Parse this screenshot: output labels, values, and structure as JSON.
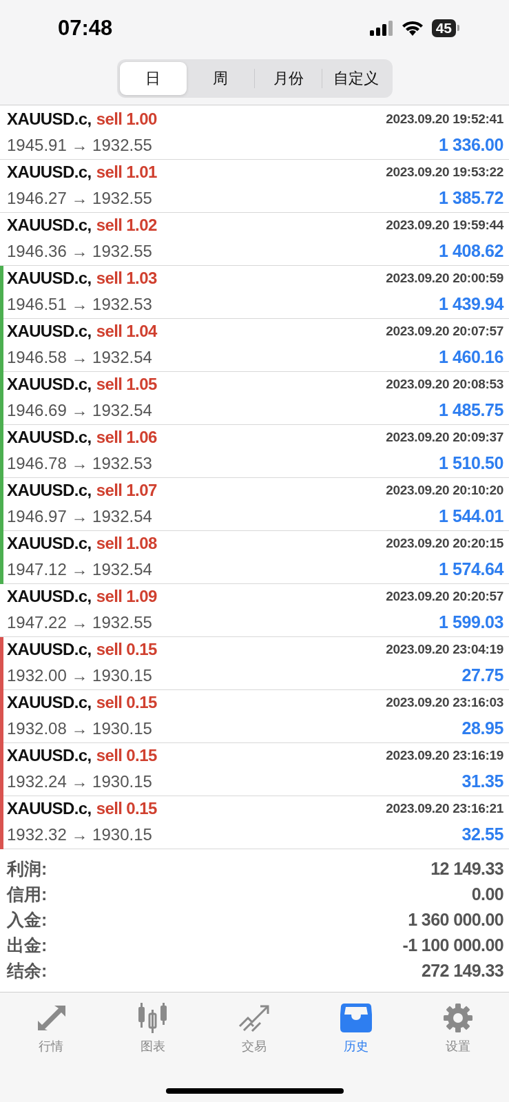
{
  "status_bar": {
    "time": "07:48",
    "battery": "45"
  },
  "segments": [
    {
      "label": "日",
      "selected": true
    },
    {
      "label": "周",
      "selected": false
    },
    {
      "label": "月份",
      "selected": false
    },
    {
      "label": "自定义",
      "selected": false
    }
  ],
  "deals": [
    {
      "symbol": "XAUUSD.c,",
      "action": "sell 1.00",
      "time": "2023.09.20 19:52:41",
      "prices": "1945.91 → 1932.55",
      "profit": "1 336.00"
    },
    {
      "symbol": "XAUUSD.c,",
      "action": "sell 1.01",
      "time": "2023.09.20 19:53:22",
      "prices": "1946.27 → 1932.55",
      "profit": "1 385.72"
    },
    {
      "symbol": "XAUUSD.c,",
      "action": "sell 1.02",
      "time": "2023.09.20 19:59:44",
      "prices": "1946.36 → 1932.55",
      "profit": "1 408.62"
    },
    {
      "symbol": "XAUUSD.c,",
      "action": "sell 1.03",
      "time": "2023.09.20 20:00:59",
      "prices": "1946.51 → 1932.53",
      "profit": "1 439.94",
      "color": "#4caf50"
    },
    {
      "symbol": "XAUUSD.c,",
      "action": "sell 1.04",
      "time": "2023.09.20 20:07:57",
      "prices": "1946.58 → 1932.54",
      "profit": "1 460.16",
      "color": "#4caf50"
    },
    {
      "symbol": "XAUUSD.c,",
      "action": "sell 1.05",
      "time": "2023.09.20 20:08:53",
      "prices": "1946.69 → 1932.54",
      "profit": "1 485.75",
      "color": "#4caf50"
    },
    {
      "symbol": "XAUUSD.c,",
      "action": "sell 1.06",
      "time": "2023.09.20 20:09:37",
      "prices": "1946.78 → 1932.53",
      "profit": "1 510.50",
      "color": "#4caf50"
    },
    {
      "symbol": "XAUUSD.c,",
      "action": "sell 1.07",
      "time": "2023.09.20 20:10:20",
      "prices": "1946.97 → 1932.54",
      "profit": "1 544.01",
      "color": "#4caf50"
    },
    {
      "symbol": "XAUUSD.c,",
      "action": "sell 1.08",
      "time": "2023.09.20 20:20:15",
      "prices": "1947.12 → 1932.54",
      "profit": "1 574.64",
      "color": "#4caf50"
    },
    {
      "symbol": "XAUUSD.c,",
      "action": "sell 1.09",
      "time": "2023.09.20 20:20:57",
      "prices": "1947.22 → 1932.55",
      "profit": "1 599.03"
    },
    {
      "symbol": "XAUUSD.c,",
      "action": "sell 0.15",
      "time": "2023.09.20 23:04:19",
      "prices": "1932.00 → 1930.15",
      "profit": "27.75",
      "color": "#d9534f"
    },
    {
      "symbol": "XAUUSD.c,",
      "action": "sell 0.15",
      "time": "2023.09.20 23:16:03",
      "prices": "1932.08 → 1930.15",
      "profit": "28.95",
      "color": "#d9534f"
    },
    {
      "symbol": "XAUUSD.c,",
      "action": "sell 0.15",
      "time": "2023.09.20 23:16:19",
      "prices": "1932.24 → 1930.15",
      "profit": "31.35",
      "color": "#d9534f"
    },
    {
      "symbol": "XAUUSD.c,",
      "action": "sell 0.15",
      "time": "2023.09.20 23:16:21",
      "prices": "1932.32 → 1930.15",
      "profit": "32.55",
      "color": "#d9534f"
    }
  ],
  "summary": [
    {
      "label": "利润:",
      "value": "12 149.33"
    },
    {
      "label": "信用:",
      "value": "0.00"
    },
    {
      "label": "入金:",
      "value": "1 360 000.00"
    },
    {
      "label": "出金:",
      "value": "-1 100 000.00"
    },
    {
      "label": "结余:",
      "value": "272 149.33"
    }
  ],
  "tab_bar": [
    {
      "label": "行情",
      "kind": "quotes",
      "selected": false
    },
    {
      "label": "图表",
      "kind": "chart",
      "selected": false
    },
    {
      "label": "交易",
      "kind": "trade",
      "selected": false
    },
    {
      "label": "历史",
      "kind": "history",
      "selected": true
    },
    {
      "label": "设置",
      "kind": "settings",
      "selected": false
    }
  ]
}
